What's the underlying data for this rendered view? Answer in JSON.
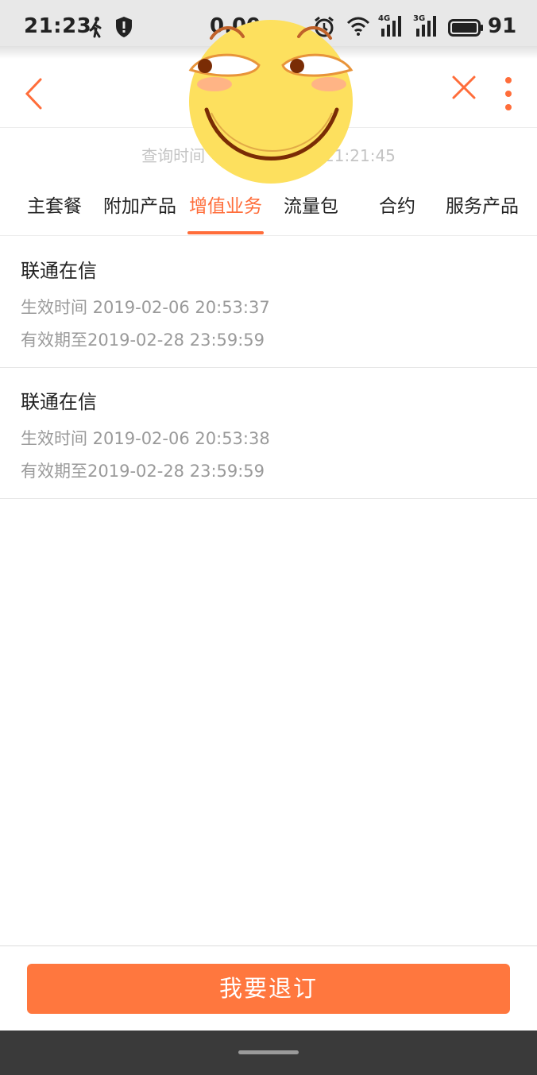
{
  "status_bar": {
    "time": "21:23",
    "speed": "0.00",
    "network_4g": "4G",
    "network_3g": "3G",
    "battery": "91",
    "icons": [
      "walk-icon",
      "shield-icon",
      "alarm-icon",
      "wifi-icon",
      "signal-4g-icon",
      "signal-3g-icon",
      "battery-icon"
    ]
  },
  "nav": {
    "back_icon": "chevron-left-icon",
    "close_icon": "close-icon",
    "more_icon": "more-vertical-icon",
    "accent_color": "#ff6d3a"
  },
  "query_time": {
    "prefix": "查询时间",
    "suffix": "21:21:45"
  },
  "tabs": [
    {
      "label": "主套餐",
      "active": false
    },
    {
      "label": "附加产品",
      "active": false
    },
    {
      "label": "增值业务",
      "active": true
    },
    {
      "label": "流量包",
      "active": false
    },
    {
      "label": "合约",
      "active": false
    },
    {
      "label": "服务产品",
      "active": false
    }
  ],
  "items": [
    {
      "title": "联通在信",
      "effective": "生效时间 2019-02-06 20:53:37",
      "expires": "有效期至2019-02-28 23:59:59"
    },
    {
      "title": "联通在信",
      "effective": "生效时间 2019-02-06 20:53:38",
      "expires": "有效期至2019-02-28 23:59:59"
    }
  ],
  "footer": {
    "unsubscribe_label": "我要退订",
    "button_color": "#ff773e"
  },
  "overlay": {
    "sticker": "smirk-emoji-sticker"
  }
}
